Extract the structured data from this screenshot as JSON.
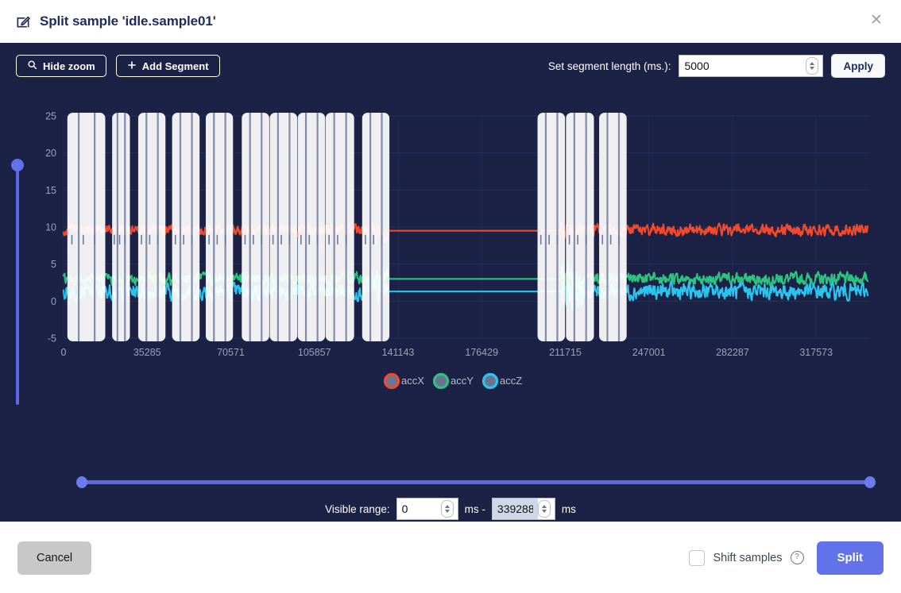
{
  "header": {
    "icon": "edit-square-icon",
    "title": "Split sample 'idle.sample01'",
    "close_label": "✕"
  },
  "toolbar": {
    "hide_zoom_label": "Hide zoom",
    "hide_zoom_icon": "search-icon",
    "add_segment_label": "Add Segment",
    "add_segment_icon": "plus-icon",
    "segment_length_label": "Set segment length (ms.):",
    "segment_length_value": "5000",
    "apply_label": "Apply"
  },
  "range": {
    "label": "Visible range:",
    "start_value": "0",
    "unit_1": "ms -",
    "end_value": "339288",
    "unit_2": "ms"
  },
  "footer": {
    "cancel_label": "Cancel",
    "shift_samples_label": "Shift samples",
    "help_icon_label": "?",
    "split_label": "Split",
    "shift_samples_checked": false
  },
  "colors": {
    "accent": "#6272e8",
    "panel_bg": "#1b2246",
    "accX": "#f4492b",
    "accY": "#2fc27f",
    "accZ": "#2bc4ef",
    "segment_band": "#ffffff",
    "segment_divider": "#5d6a90"
  },
  "chart_data": {
    "type": "line",
    "title": "",
    "xlabel": "",
    "ylabel": "",
    "xlim": [
      0,
      339288
    ],
    "ylim": [
      -5,
      25
    ],
    "grid": true,
    "legend_position": "bottom",
    "xticks": [
      0,
      35285,
      70571,
      105857,
      141143,
      176429,
      211715,
      247001,
      282287,
      317573
    ],
    "xtick_labels": [
      "0",
      "35285",
      "70571",
      "105857",
      "141143",
      "176429",
      "211715",
      "247001",
      "282287",
      "317573"
    ],
    "yticks": [
      -5,
      0,
      5,
      10,
      15,
      20,
      25
    ],
    "ytick_labels": [
      "-5",
      "0",
      "5",
      "10",
      "15",
      "20",
      "25"
    ],
    "series": [
      {
        "name": "accX",
        "color": "#f4492b",
        "baseline": 9.6,
        "noise": 1.1,
        "flat_value": 9.5
      },
      {
        "name": "accY",
        "color": "#2fc27f",
        "baseline": 3.0,
        "noise": 1.2,
        "flat_value": 3.0
      },
      {
        "name": "accZ",
        "color": "#2bc4ef",
        "baseline": 1.3,
        "noise": 1.6,
        "flat_value": 1.3
      }
    ],
    "flat_region_ms": [
      137000,
      210000
    ],
    "segments": [
      {
        "start_ms": 1600,
        "end_ms": 17600
      },
      {
        "start_ms": 20500,
        "end_ms": 28000
      },
      {
        "start_ms": 31500,
        "end_ms": 43000
      },
      {
        "start_ms": 45800,
        "end_ms": 57400
      },
      {
        "start_ms": 60000,
        "end_ms": 71500
      },
      {
        "start_ms": 75200,
        "end_ms": 86800
      },
      {
        "start_ms": 87000,
        "end_ms": 98600
      },
      {
        "start_ms": 98800,
        "end_ms": 110400
      },
      {
        "start_ms": 110600,
        "end_ms": 122600
      },
      {
        "start_ms": 126000,
        "end_ms": 137500
      },
      {
        "start_ms": 200000,
        "end_ms": 211600
      },
      {
        "start_ms": 212000,
        "end_ms": 223800
      },
      {
        "start_ms": 226000,
        "end_ms": 237600
      }
    ]
  },
  "legend": [
    {
      "label": "accX",
      "color": "#f4492b"
    },
    {
      "label": "accY",
      "color": "#2fc27f"
    },
    {
      "label": "accZ",
      "color": "#2bc4ef"
    }
  ]
}
